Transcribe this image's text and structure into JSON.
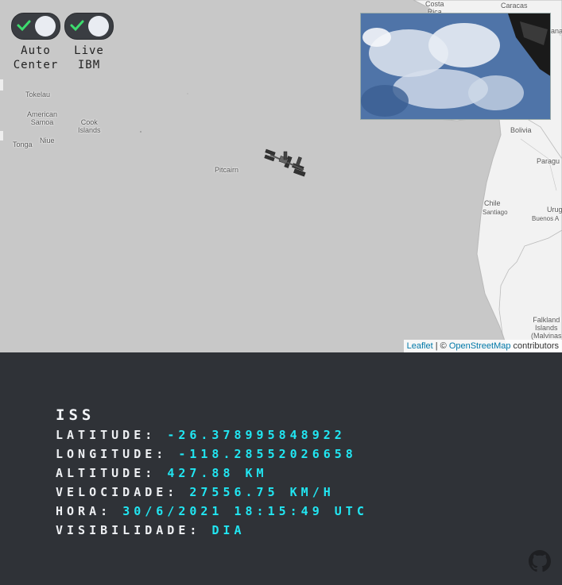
{
  "toggles": [
    {
      "label_line1": "Auto",
      "label_line2": "Center",
      "checked": true
    },
    {
      "label_line1": "Live",
      "label_line2": "IBM",
      "checked": true
    }
  ],
  "map_labels": {
    "costa_rica_1": "Costa",
    "costa_rica_2": "Rica",
    "caracas": "Caracas",
    "tokelau": "Tokelau",
    "american_samoa_1": "American",
    "american_samoa_2": "Samoa",
    "cook_islands_1": "Cook",
    "cook_islands_2": "Islands",
    "tonga": "Tonga",
    "niue": "Niue",
    "pitcairn": "Pitcairn",
    "bolivia": "Bolivia",
    "paraguay": "Paragu",
    "chile": "Chile",
    "santiago": "Santiago",
    "uruguay": "Urug",
    "buenos_aires": "Buenos A",
    "falkland_1": "Falkland",
    "falkland_2": "Islands",
    "falkland_3": "(Malvinas",
    "guyana": "ana"
  },
  "attribution": {
    "leaflet": "Leaflet",
    "sep": " | © ",
    "osm": "OpenStreetMap",
    "contributors": " contributors"
  },
  "iss": {
    "title": "ISS",
    "latitude_label": "LATITUDE: ",
    "latitude": "-26.378995848922",
    "longitude_label": "LONGITUDE: ",
    "longitude": "-118.28552026658",
    "altitude_label": "ALTITUDE: ",
    "altitude": "427.88 KM",
    "velocity_label": "VELOCIDADE: ",
    "velocity": "27556.75 KM/H",
    "time_label": "HORA: ",
    "time": "30/6/2021 18:15:49 UTC",
    "visibility_label": "VISIBILIDADE: ",
    "visibility": "DIA"
  },
  "icons": {
    "github": "github-icon",
    "check": "check-icon",
    "iss": "iss-icon"
  },
  "colors": {
    "accent": "#21e6f2",
    "panel_bg": "#2f3237",
    "ocean": "#c8c8c8",
    "check": "#3ddc6e"
  }
}
